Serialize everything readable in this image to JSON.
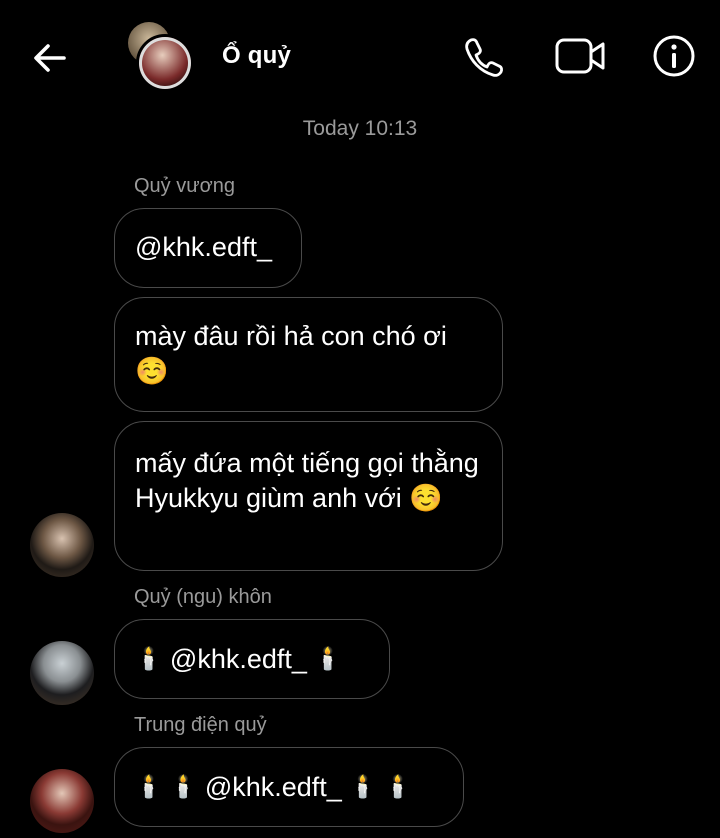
{
  "header": {
    "back_icon": "arrow-left-icon",
    "title": "Ổ quỷ",
    "call_icon": "phone-icon",
    "video_icon": "video-camera-icon",
    "info_icon": "info-icon"
  },
  "timestamp": "Today 10:13",
  "messages": {
    "sender1": "Quỷ vương",
    "m1": "@khk.edft_",
    "m2": "mày đâu rồi hả con chó ơi ☺️",
    "m3": "mấy đứa một tiếng gọi thằng Hyukkyu giùm anh với ☺️",
    "sender2": "Quỷ (ngu) khôn",
    "m4_mention": "@khk.edft_",
    "sender3": "Trung điện quỷ",
    "m5_mention": "@khk.edft_",
    "candle": "🕯️"
  },
  "colors": {
    "background": "#000000",
    "bubble_border": "#4a4a4a",
    "meta_text": "#9a9a9a"
  }
}
